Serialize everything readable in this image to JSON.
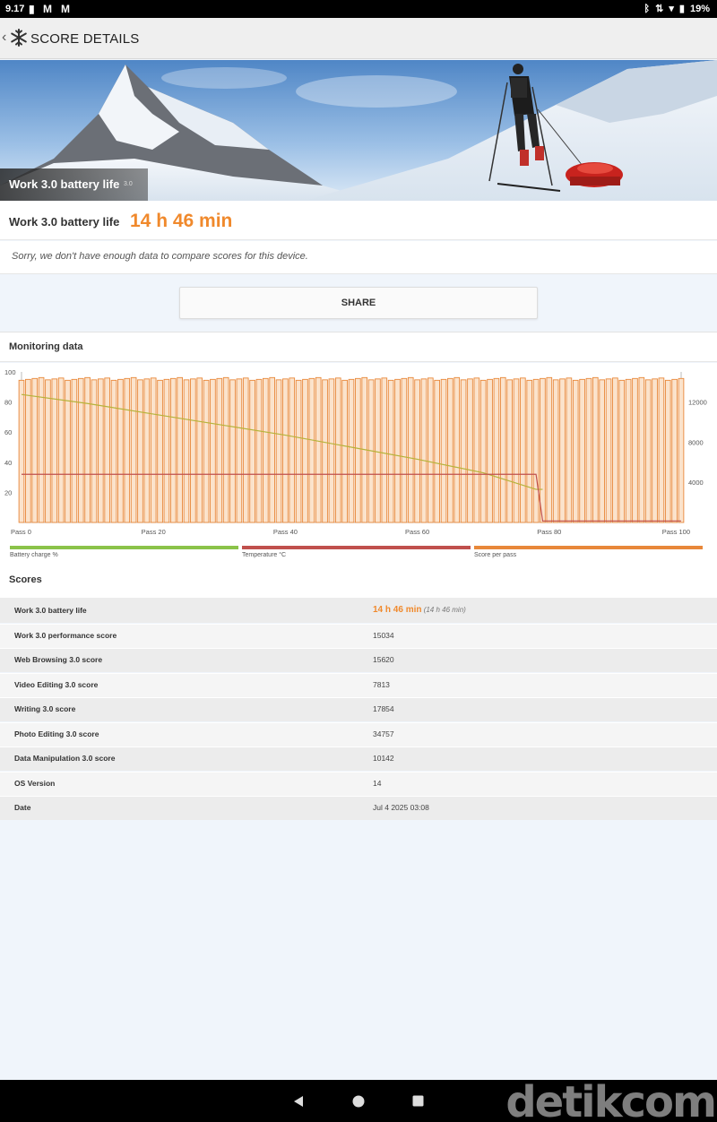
{
  "status_bar": {
    "time": "9.17",
    "battery": "19%"
  },
  "app_bar": {
    "title": "SCORE DETAILS"
  },
  "hero": {
    "label": "Work 3.0 battery life",
    "version": "3.0"
  },
  "result": {
    "name": "Work 3.0 battery life",
    "score": "14 h 46 min"
  },
  "note": "Sorry, we don't have enough data to compare scores for this device.",
  "share_label": "SHARE",
  "monitoring": {
    "title": "Monitoring data"
  },
  "legend": [
    "Battery charge %",
    "Temperature °C",
    "Score per pass"
  ],
  "colors": {
    "accent": "#f0892c",
    "battery": "#8bc34a",
    "temperature": "#c0504d",
    "score": "#e8883a"
  },
  "chart_data": {
    "type": "bar",
    "left_ticks": [
      "100",
      "80",
      "60",
      "40",
      "20"
    ],
    "right_ticks": [
      "12000",
      "8000",
      "4000"
    ],
    "x_ticks": [
      "Pass 0",
      "Pass 20",
      "Pass 40",
      "Pass 60",
      "Pass 80",
      "Pass 100"
    ],
    "ylim_left": [
      0,
      100
    ],
    "ylim_right": [
      0,
      15000
    ],
    "xlim": [
      0,
      100
    ],
    "series": [
      {
        "name": "Score per pass",
        "axis": "right",
        "type": "bar",
        "x_range": [
          0,
          100
        ],
        "count": 101,
        "approx_value": 14300
      },
      {
        "name": "Battery charge %",
        "axis": "left",
        "type": "line",
        "points": [
          [
            0,
            85
          ],
          [
            10,
            79
          ],
          [
            20,
            72
          ],
          [
            30,
            65
          ],
          [
            40,
            58
          ],
          [
            50,
            50
          ],
          [
            60,
            42
          ],
          [
            70,
            33
          ],
          [
            78,
            22
          ],
          [
            79,
            22
          ]
        ]
      },
      {
        "name": "Temperature °C",
        "axis": "left",
        "type": "line",
        "points": [
          [
            0,
            32
          ],
          [
            78,
            32
          ],
          [
            79,
            1
          ],
          [
            100,
            1
          ]
        ]
      }
    ]
  },
  "scores": {
    "title": "Scores",
    "rows": [
      {
        "label": "Work 3.0 battery life",
        "value": "14 h 46 min",
        "sub": "(14 h 46 min)"
      },
      {
        "label": "Work 3.0 performance score",
        "value": "15034"
      },
      {
        "label": "Web Browsing 3.0 score",
        "value": "15620"
      },
      {
        "label": "Video Editing 3.0 score",
        "value": "7813"
      },
      {
        "label": "Writing 3.0 score",
        "value": "17854"
      },
      {
        "label": "Photo Editing 3.0 score",
        "value": "34757"
      },
      {
        "label": "Data Manipulation 3.0 score",
        "value": "10142"
      },
      {
        "label": "OS Version",
        "value": "14"
      },
      {
        "label": "Date",
        "value": "Jul 4 2025 03:08"
      }
    ]
  },
  "watermark": "detikcom"
}
